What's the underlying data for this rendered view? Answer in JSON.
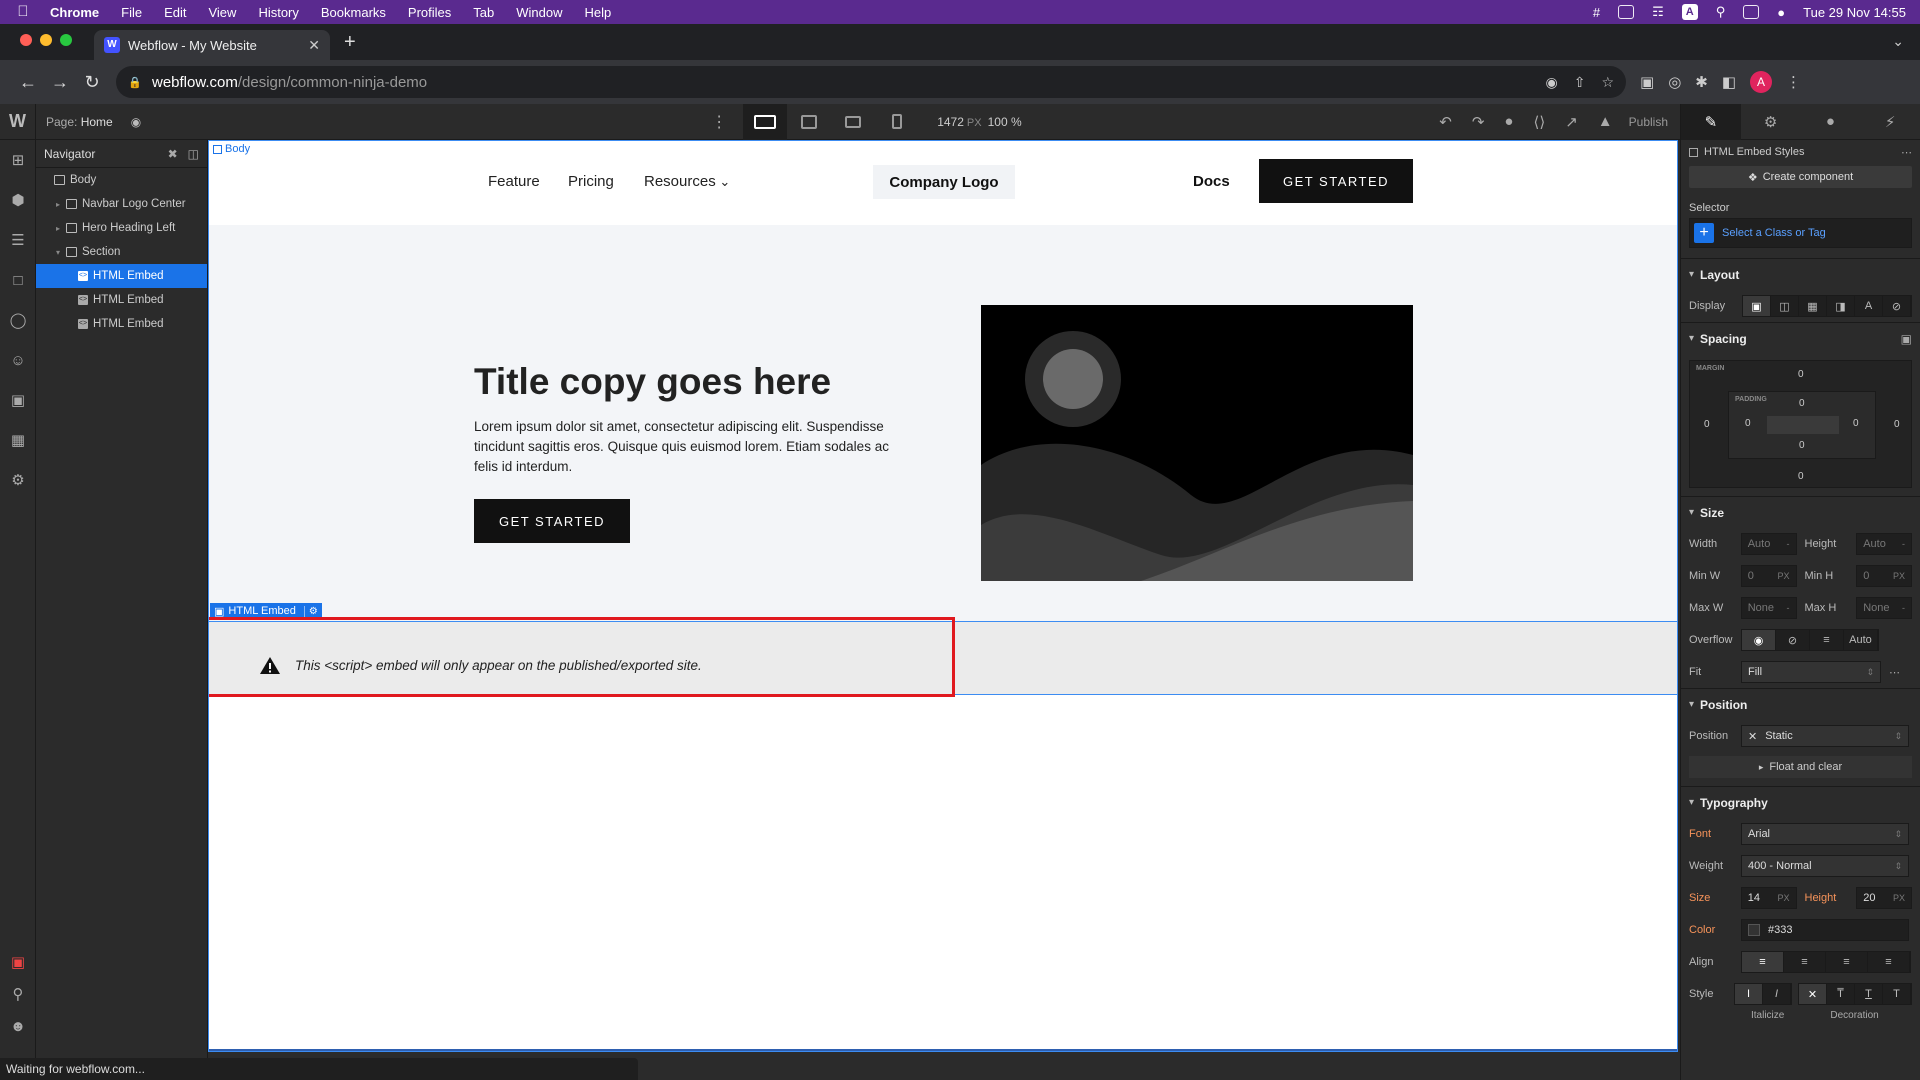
{
  "menubar": {
    "app": "Chrome",
    "items": [
      "File",
      "Edit",
      "View",
      "History",
      "Bookmarks",
      "Profiles",
      "Tab",
      "Window",
      "Help"
    ],
    "clock": "Tue 29 Nov  14:55"
  },
  "browser": {
    "tab_title": "Webflow - My Website",
    "favicon": "W",
    "url_host": "webflow.com",
    "url_path": "/design/common-ninja-demo",
    "avatar_letter": "A"
  },
  "designer": {
    "page_label": "Page:",
    "page_name": "Home",
    "canvas_width": "1472",
    "canvas_unit": "PX",
    "zoom": "100 %",
    "publish_label": "Publish"
  },
  "navigator": {
    "title": "Navigator",
    "items": [
      {
        "label": "Body",
        "depth": 0,
        "type": "box"
      },
      {
        "label": "Navbar Logo Center",
        "depth": 1,
        "type": "box",
        "twisty": "closed"
      },
      {
        "label": "Hero Heading Left",
        "depth": 1,
        "type": "box",
        "twisty": "closed"
      },
      {
        "label": "Section",
        "depth": 1,
        "type": "box",
        "twisty": "open"
      },
      {
        "label": "HTML Embed",
        "depth": 2,
        "type": "embed",
        "selected": true
      },
      {
        "label": "HTML Embed",
        "depth": 2,
        "type": "embed"
      },
      {
        "label": "HTML Embed",
        "depth": 2,
        "type": "embed"
      }
    ]
  },
  "canvas": {
    "body_tag": "Body",
    "nav_links": [
      "Feature",
      "Pricing",
      "Resources"
    ],
    "logo": "Company Logo",
    "docs": "Docs",
    "nav_cta": "GET STARTED",
    "hero_title": "Title copy goes here",
    "hero_text": "Lorem ipsum dolor sit amet, consectetur adipiscing elit. Suspendisse tincidunt sagittis eros. Quisque quis euismod lorem. Etiam sodales ac felis id interdum.",
    "hero_cta": "GET STARTED",
    "embed_label": "HTML Embed",
    "embed_warning": "This <script> embed will only appear on the published/exported site."
  },
  "status": "Waiting for webflow.com...",
  "style_panel": {
    "element_title": "HTML Embed Styles",
    "create_component": "Create component",
    "selector_label": "Selector",
    "selector_placeholder": "Select a Class or Tag",
    "layout": {
      "title": "Layout",
      "display_label": "Display"
    },
    "spacing": {
      "title": "Spacing",
      "margin_tag": "MARGIN",
      "padding_tag": "PADDING",
      "margin": {
        "top": "0",
        "right": "0",
        "bottom": "0",
        "left": "0"
      },
      "padding": {
        "top": "0",
        "right": "0",
        "bottom": "0",
        "left": "0"
      }
    },
    "size": {
      "title": "Size",
      "width_label": "Width",
      "width": "Auto",
      "height_label": "Height",
      "height": "Auto",
      "minw_label": "Min W",
      "minw": "0",
      "minw_unit": "PX",
      "minh_label": "Min H",
      "minh": "0",
      "minh_unit": "PX",
      "maxw_label": "Max W",
      "maxw": "None",
      "maxh_label": "Max H",
      "maxh": "None",
      "overflow_label": "Overflow",
      "overflow_auto": "Auto",
      "fit_label": "Fit",
      "fit": "Fill"
    },
    "position": {
      "title": "Position",
      "label": "Position",
      "value": "Static",
      "float_clear": "Float and clear"
    },
    "typography": {
      "title": "Typography",
      "font_label": "Font",
      "font": "Arial",
      "weight_label": "Weight",
      "weight": "400 - Normal",
      "size_label": "Size",
      "size": "14",
      "size_unit": "PX",
      "height_label": "Height",
      "height": "20",
      "height_unit": "PX",
      "color_label": "Color",
      "color": "#333",
      "align_label": "Align",
      "style_label": "Style",
      "italicize_label": "Italicize",
      "decoration_label": "Decoration"
    }
  },
  "colors": {
    "menubar": "#5a2a8f",
    "selection_blue": "#1a73e8",
    "highlight_red": "#e0181e",
    "orange_label": "#f6935a"
  }
}
